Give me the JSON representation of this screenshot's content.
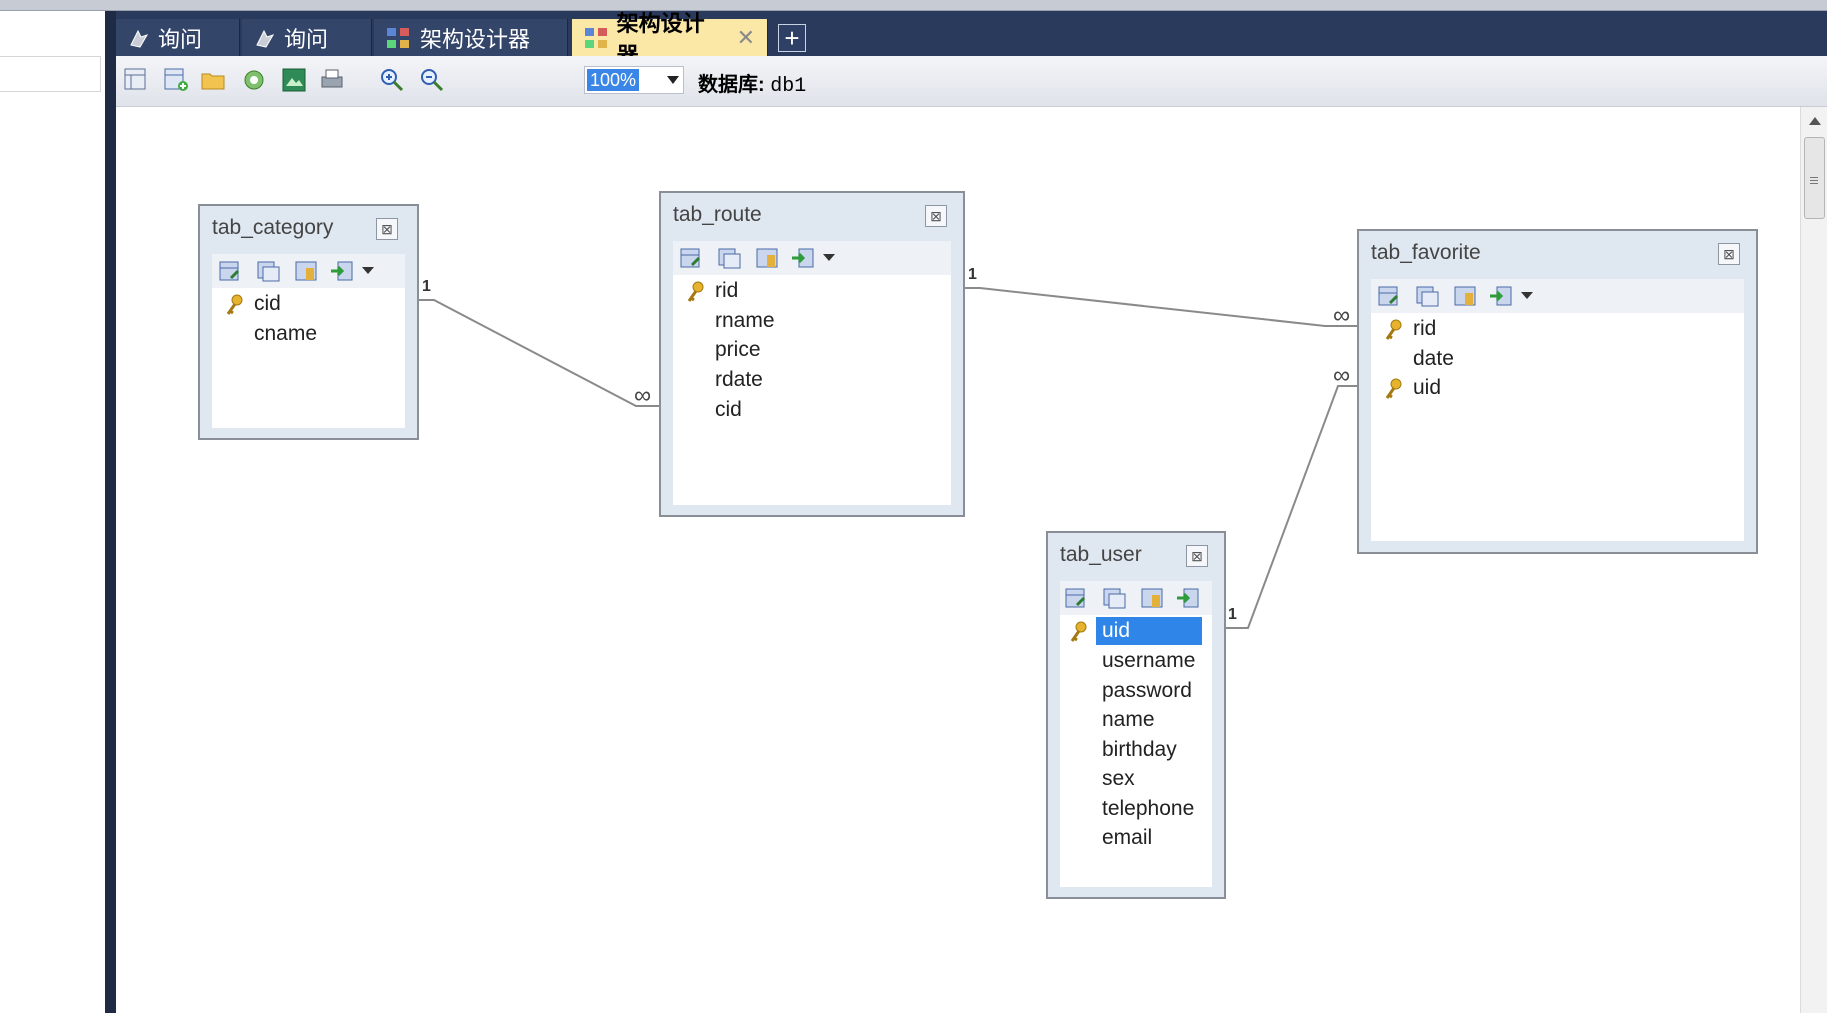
{
  "tabs": [
    {
      "label": "询问",
      "active": false
    },
    {
      "label": "询问",
      "active": false
    },
    {
      "label": "架构设计器",
      "active": false
    },
    {
      "label": "架构设计器",
      "active": true,
      "close": "✕"
    }
  ],
  "add_tab": "+",
  "toolbar": {
    "zoom": "100%",
    "db_label": "数据库:",
    "db_name": "db1"
  },
  "tables": {
    "category": {
      "title": "tab_category",
      "fields": [
        "cid",
        "cname"
      ]
    },
    "route": {
      "title": "tab_route",
      "fields": [
        "rid",
        "rname",
        "price",
        "rdate",
        "cid"
      ]
    },
    "favorite": {
      "title": "tab_favorite",
      "fields": [
        "rid",
        "date",
        "uid"
      ]
    },
    "user": {
      "title": "tab_user",
      "fields": [
        "uid",
        "username",
        "password",
        "name",
        "birthday",
        "sex",
        "telephone",
        "email"
      ]
    }
  },
  "relations": {
    "one": "1",
    "many": "∞"
  },
  "colors": {
    "tab_bar": "#2a3a5c",
    "active_tab": "#fbe8a6",
    "selection": "#2f86e8",
    "table_frame": "#dfe7f1"
  }
}
